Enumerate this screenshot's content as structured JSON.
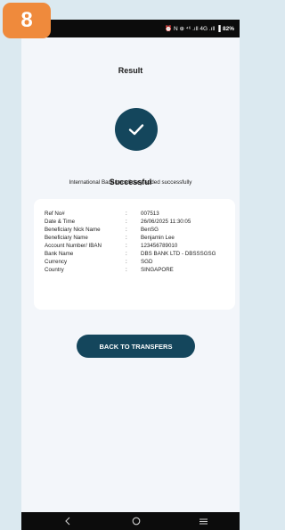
{
  "step": {
    "number": "8"
  },
  "status_bar": {
    "icons_text": "⏰ N ⊕ ⁴⁶ .ıll 4G .ıll",
    "battery": "▌82%"
  },
  "header": {
    "title": "Result"
  },
  "result": {
    "status": "Successful",
    "message": "International Bank beneficiary added successfully"
  },
  "details": [
    {
      "label": "Ref No#",
      "value": "007513"
    },
    {
      "label": "Date & Time",
      "value": "26/06/2025 11:30:05"
    },
    {
      "label": "Beneficiary Nick Name",
      "value": "BenSG"
    },
    {
      "label": "Beneficiary Name",
      "value": "Benjamin Lee"
    },
    {
      "label": "Account Number/ IBAN",
      "value": "123456789010"
    },
    {
      "label": "Bank Name",
      "value": "DBS BANK LTD - DBSSSGSG"
    },
    {
      "label": "Currency",
      "value": "SGD"
    },
    {
      "label": "Country",
      "value": "SINGAPORE"
    }
  ],
  "separator": ":",
  "actions": {
    "back_label": "BACK TO TRANSFERS"
  },
  "colors": {
    "primary": "#14465c",
    "badge": "#ef8a3c",
    "page_bg": "#dbe9f0",
    "screen_bg": "#f3f6fa"
  },
  "nav": {
    "back_icon": "back-icon",
    "home_icon": "home-icon",
    "menu_icon": "menu-icon"
  }
}
